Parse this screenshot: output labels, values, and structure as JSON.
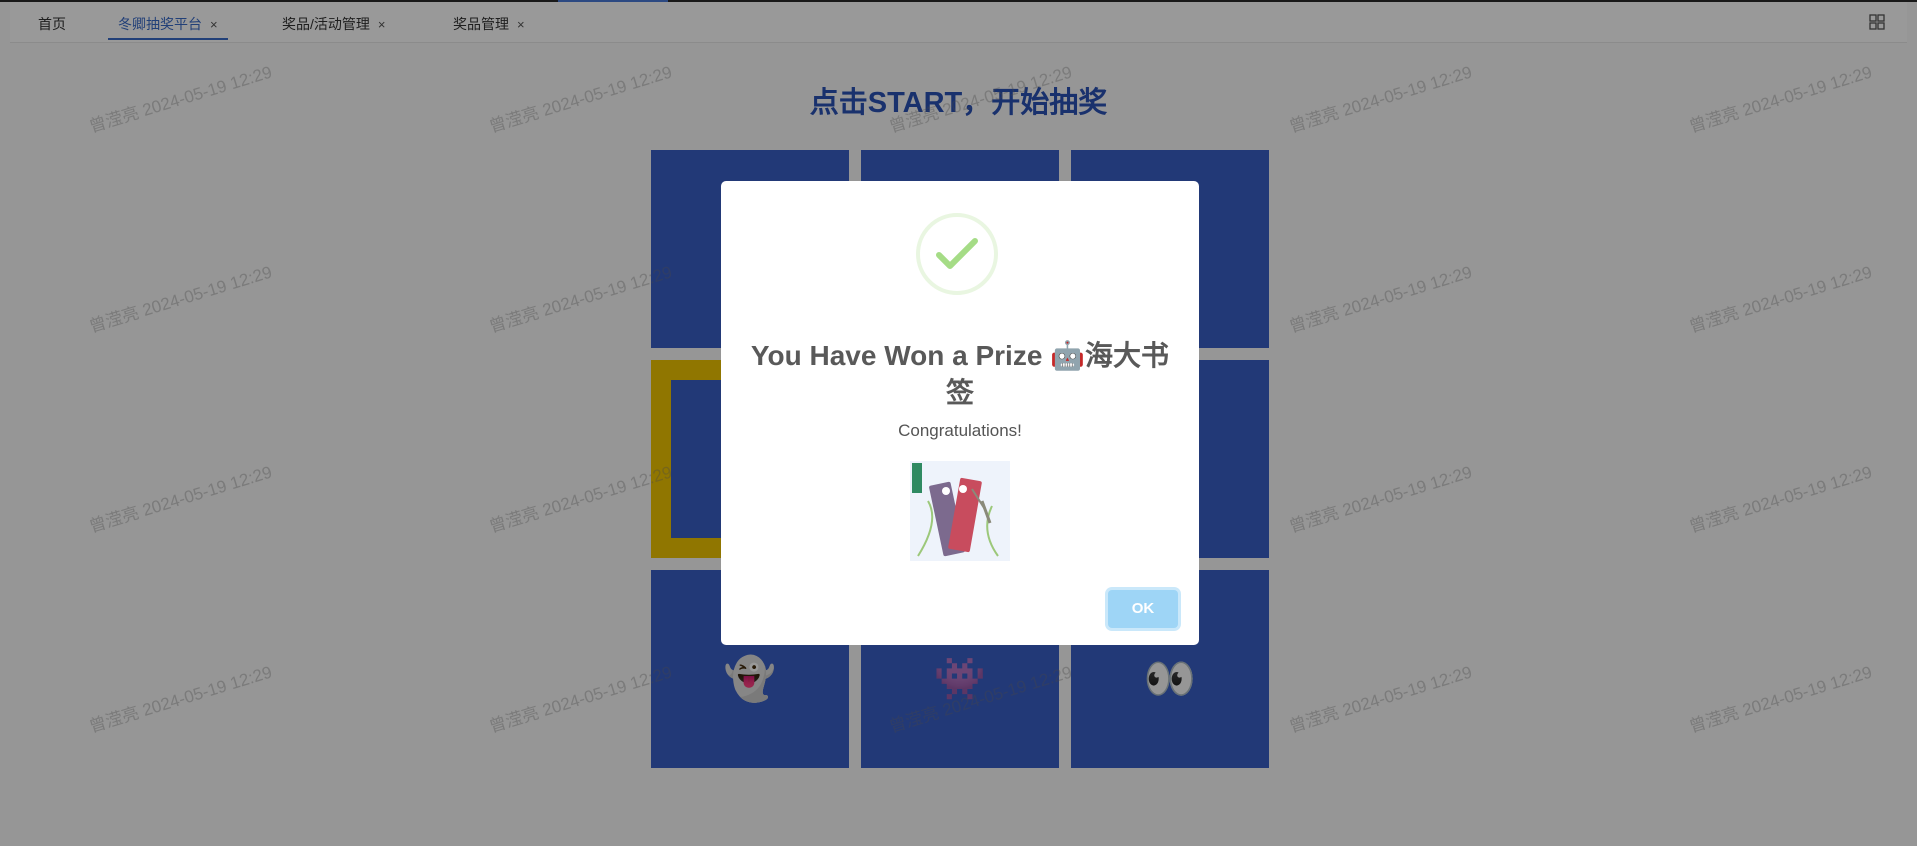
{
  "tabs": [
    {
      "label": "首页",
      "closable": false,
      "active": false
    },
    {
      "label": "冬卿抽奖平台",
      "closable": true,
      "active": true
    },
    {
      "label": "奖品/活动管理",
      "closable": true,
      "active": false
    },
    {
      "label": "奖品管理",
      "closable": true,
      "active": false
    }
  ],
  "close_glyph": "×",
  "main": {
    "title": "点击START，开始抽奖"
  },
  "watermark": "曾滢亮 2024-05-19 12:29",
  "grid": {
    "cells": [
      {
        "emoji": ""
      },
      {
        "emoji": ""
      },
      {
        "emoji": ""
      },
      {
        "emoji": "",
        "selected": true
      },
      {
        "emoji": ""
      },
      {
        "emoji": ""
      },
      {
        "emoji": "👻"
      },
      {
        "emoji": "👾"
      },
      {
        "emoji": "👀"
      }
    ]
  },
  "modal": {
    "title": "You Have Won a Prize 🤖海大书签",
    "text": "Congratulations!",
    "ok_label": "OK",
    "icon": "success-check-icon"
  },
  "colors": {
    "accent": "#3a6bc9",
    "cell": "#3a5fc6",
    "selected": "#f1c500",
    "success": "#a5dc86",
    "ok_button": "#9ed5f6"
  }
}
